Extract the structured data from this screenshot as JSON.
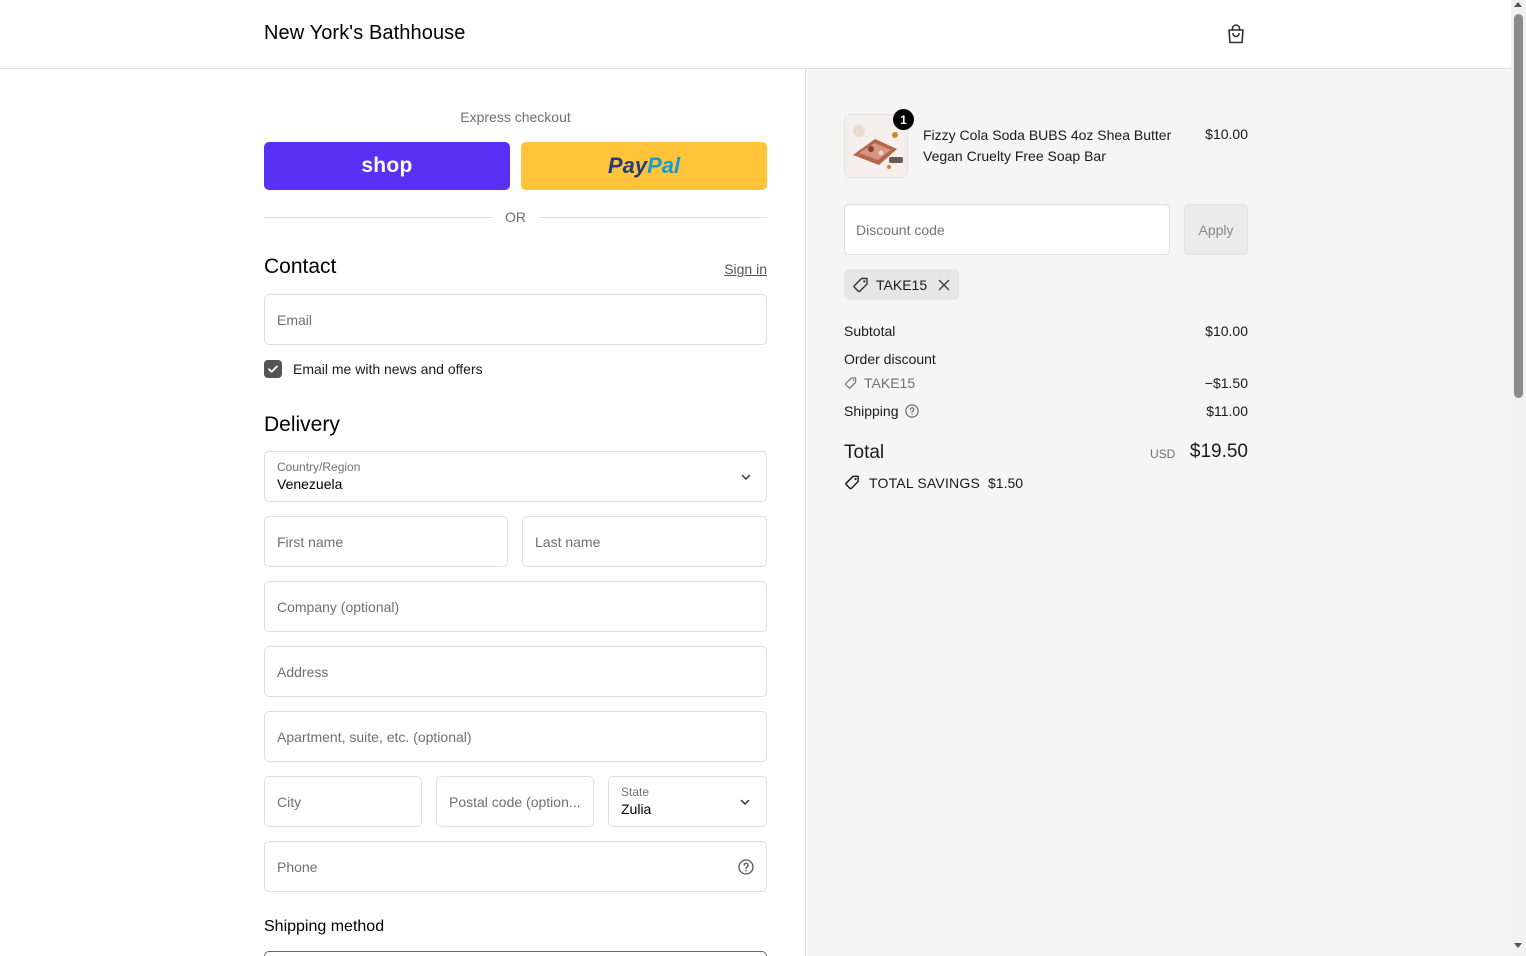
{
  "header": {
    "store_name": "New York's Bathhouse",
    "cart_icon": "shopping-bag-icon"
  },
  "express": {
    "label": "Express checkout",
    "shop_label": "shop",
    "paypal_part1": "Pay",
    "paypal_part2": "Pal",
    "or_label": "OR"
  },
  "contact": {
    "title": "Contact",
    "signin_label": "Sign in",
    "email_placeholder": "Email",
    "newsletter_label": "Email me with news and offers",
    "newsletter_checked": true
  },
  "delivery": {
    "title": "Delivery",
    "country_label": "Country/Region",
    "country_value": "Venezuela",
    "first_name_placeholder": "First name",
    "last_name_placeholder": "Last name",
    "company_placeholder": "Company (optional)",
    "address_placeholder": "Address",
    "apartment_placeholder": "Apartment, suite, etc. (optional)",
    "city_placeholder": "City",
    "postal_placeholder": "Postal code (option...",
    "state_label": "State",
    "state_value": "Zulia",
    "phone_placeholder": "Phone"
  },
  "shipping_method": {
    "title": "Shipping method"
  },
  "summary": {
    "product": {
      "name": "Fizzy Cola Soda BUBS 4oz Shea Butter Vegan Cruelty Free Soap Bar",
      "price": "$10.00",
      "quantity": "1"
    },
    "discount_placeholder": "Discount code",
    "apply_label": "Apply",
    "applied_code": "TAKE15",
    "subtotal_label": "Subtotal",
    "subtotal_value": "$10.00",
    "order_discount_label": "Order discount",
    "discount_code_label": "TAKE15",
    "discount_value": "−$1.50",
    "shipping_label": "Shipping",
    "shipping_value": "$11.00",
    "total_label": "Total",
    "total_currency": "USD",
    "total_value": "$19.50",
    "savings_label": "TOTAL SAVINGS",
    "savings_value": "$1.50"
  },
  "colors": {
    "shop_purple": "#5a31f4",
    "paypal_yellow": "#ffc439",
    "summary_bg": "#f5f5f5"
  }
}
